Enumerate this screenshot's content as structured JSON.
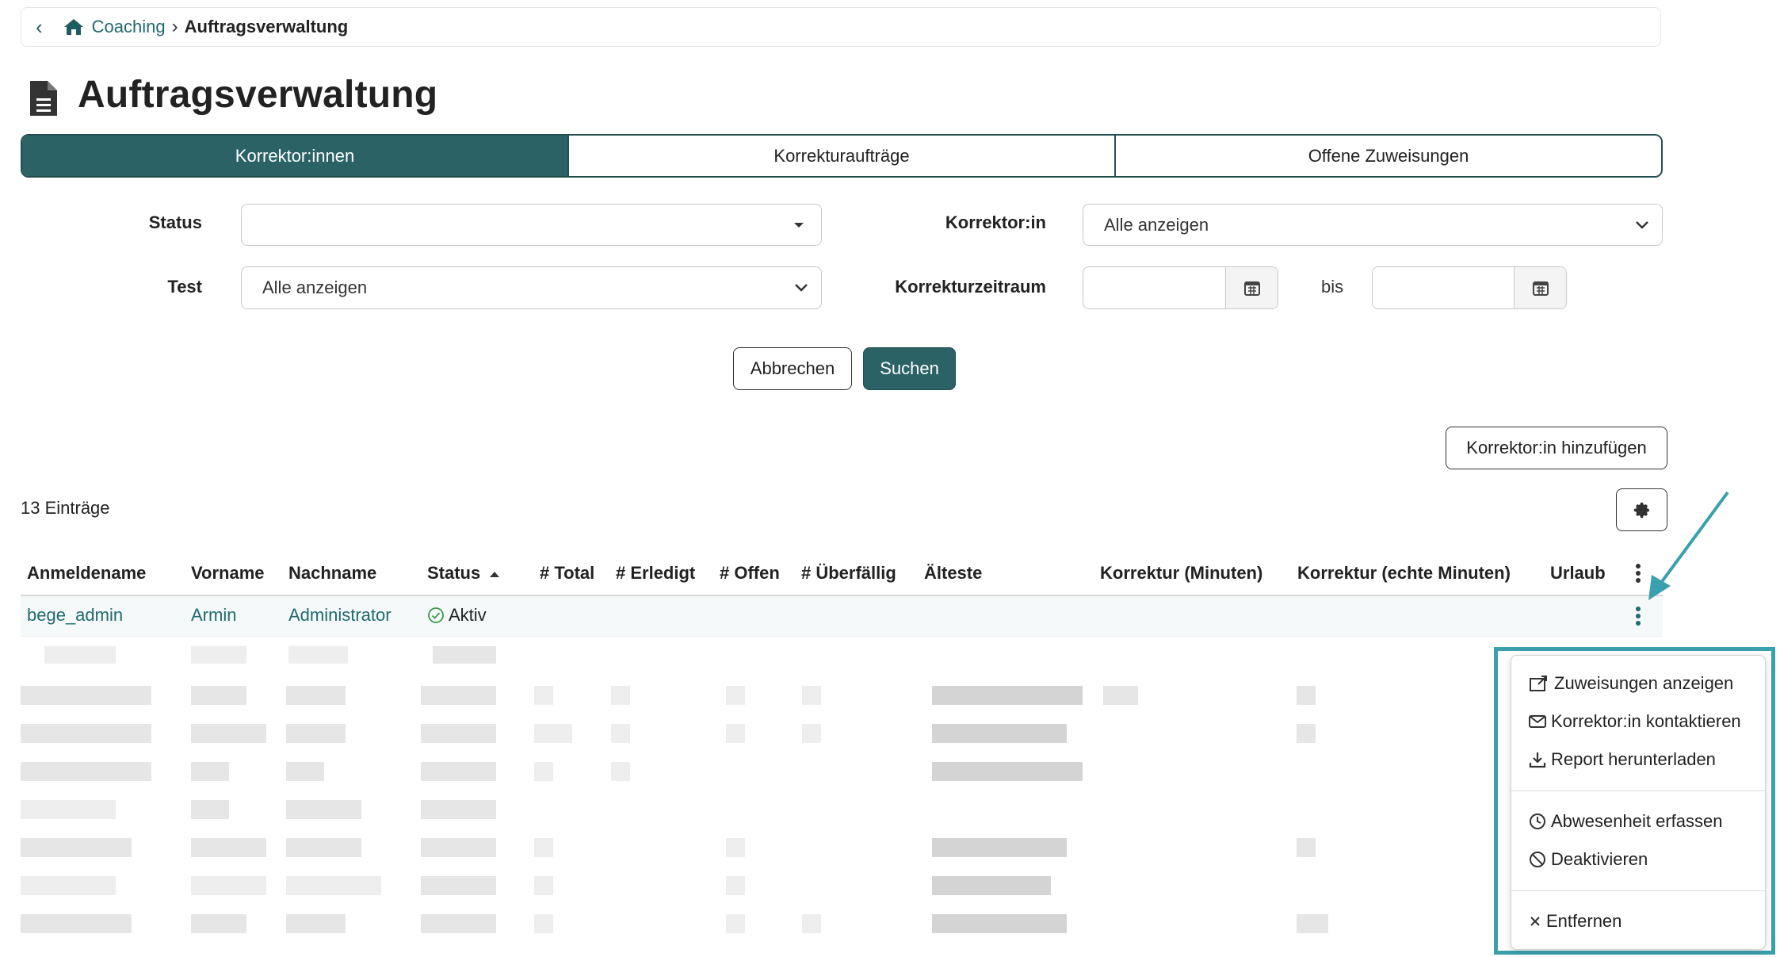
{
  "breadcrumb": {
    "back_icon": "chevron-left-icon",
    "home_icon": "home-icon",
    "link": "Coaching",
    "current": "Auftragsverwaltung"
  },
  "page": {
    "title": "Auftragsverwaltung",
    "title_icon": "document-icon"
  },
  "tabs": [
    {
      "label": "Korrektor:innen",
      "active": true
    },
    {
      "label": "Korrekturaufträge",
      "active": false
    },
    {
      "label": "Offene Zuweisungen",
      "active": false
    }
  ],
  "filters": {
    "status_label": "Status",
    "status_value": "",
    "test_label": "Test",
    "test_value": "Alle anzeigen",
    "korrektor_label": "Korrektor:in",
    "korrektor_value": "Alle anzeigen",
    "zeitraum_label": "Korrekturzeitraum",
    "bis_label": "bis",
    "cancel_label": "Abbrechen",
    "search_label": "Suchen"
  },
  "add_button_label": "Korrektor:in hinzufügen",
  "entries_count": "13 Einträge",
  "table": {
    "headers": {
      "anmeldename": "Anmeldename",
      "vorname": "Vorname",
      "nachname": "Nachname",
      "status": "Status",
      "total": "# Total",
      "erledigt": "# Erledigt",
      "offen": "# Offen",
      "ueberfaellig": "# Überfällig",
      "aelteste": "Älteste",
      "korrektur_min": "Korrektur (Minuten)",
      "korrektur_echt": "Korrektur (echte Minuten)",
      "urlaub": "Urlaub"
    },
    "row1": {
      "anmeldename": "bege_admin",
      "vorname": "Armin",
      "nachname": "Administrator",
      "status": "Aktiv"
    }
  },
  "menu": {
    "items": [
      {
        "label": "Zuweisungen anzeigen",
        "icon": "external-link-icon"
      },
      {
        "label": "Korrektor:in kontaktieren",
        "icon": "envelope-icon"
      },
      {
        "label": "Report herunterladen",
        "icon": "download-icon"
      },
      {
        "label": "Abwesenheit erfassen",
        "icon": "clock-icon"
      },
      {
        "label": "Deaktivieren",
        "icon": "ban-icon"
      },
      {
        "label": "Entfernen",
        "icon": "close-icon"
      }
    ]
  },
  "colors": {
    "primary": "#2a6266",
    "link": "#1f6a6f",
    "highlight": "#3aa0ad"
  }
}
